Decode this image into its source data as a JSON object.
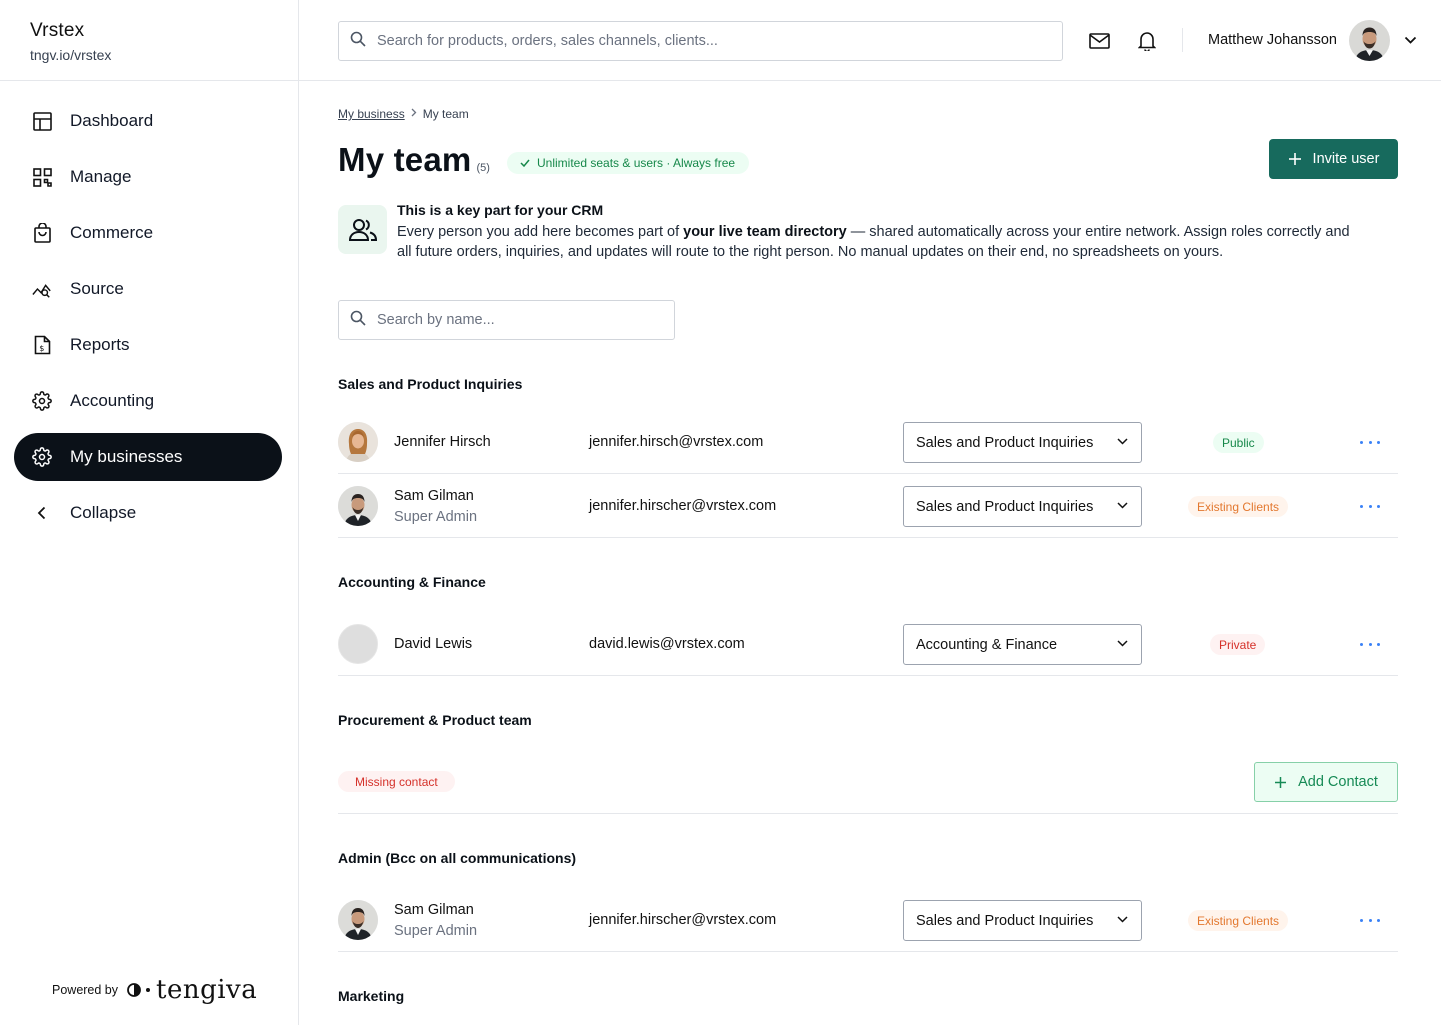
{
  "brand": {
    "name": "Vrstex",
    "url": "tngv.io/vrstex"
  },
  "nav": [
    {
      "label": "Dashboard",
      "icon": "dashboard-icon"
    },
    {
      "label": "Manage",
      "icon": "grid-icon"
    },
    {
      "label": "Commerce",
      "icon": "shopping-bag-icon"
    },
    {
      "label": "Source",
      "icon": "trend-icon"
    },
    {
      "label": "Reports",
      "icon": "report-icon"
    },
    {
      "label": "Accounting",
      "icon": "gear-icon"
    },
    {
      "label": "My businesses",
      "icon": "gear-icon",
      "active": true
    },
    {
      "label": "Collapse",
      "icon": "chevron-left-icon"
    }
  ],
  "powered": {
    "label": "Powered by",
    "logo_text": "tengiva"
  },
  "topbar": {
    "search_placeholder": "Search for products, orders, sales channels, clients...",
    "user_name": "Matthew Johansson"
  },
  "breadcrumb": {
    "parent": "My business",
    "current": "My team"
  },
  "page": {
    "title": "My team",
    "count": "(5)",
    "seat_pill": "Unlimited seats & users · Always free",
    "invite_label": "Invite user"
  },
  "info": {
    "title": "This is a key part for your CRM",
    "text_before": "Every person you add here becomes part of ",
    "text_bold": "your live team directory",
    "text_after": " — shared automatically across your entire network. Assign roles correctly and all future orders, inquiries, and updates will route to the right person. No manual updates on their end, no spreadsheets on yours."
  },
  "team_search_placeholder": "Search by name...",
  "sections": {
    "sales": "Sales and Product Inquiries",
    "accounting": "Accounting & Finance",
    "procurement": "Procurement & Product team",
    "admin": "Admin (Bcc on all communications)",
    "marketing": "Marketing"
  },
  "members": [
    {
      "name": "Jennifer Hirsch",
      "role": "",
      "email": "jennifer.hirsch@vrstex.com",
      "department": "Sales and Product Inquiries",
      "visibility": "Public"
    },
    {
      "name": "Sam Gilman",
      "role": "Super Admin",
      "email": "jennifer.hirscher@vrstex.com",
      "department": "Sales and Product Inquiries",
      "visibility": "Existing Clients"
    },
    {
      "name": "David Lewis",
      "role": "",
      "email": "david.lewis@vrstex.com",
      "department": "Accounting & Finance",
      "visibility": "Private"
    },
    {
      "name": "Sam Gilman",
      "role": "Super Admin",
      "email": "jennifer.hirscher@vrstex.com",
      "department": "Sales and Product Inquiries",
      "visibility": "Existing Clients"
    }
  ],
  "procurement": {
    "missing_label": "Missing contact",
    "add_label": "Add Contact"
  },
  "colors": {
    "accent": "#176a5d",
    "active_nav": "#0b1118",
    "public": "#16884a",
    "existing": "#e3782f",
    "private": "#d5312a",
    "link_dots": "#3b82f6"
  }
}
